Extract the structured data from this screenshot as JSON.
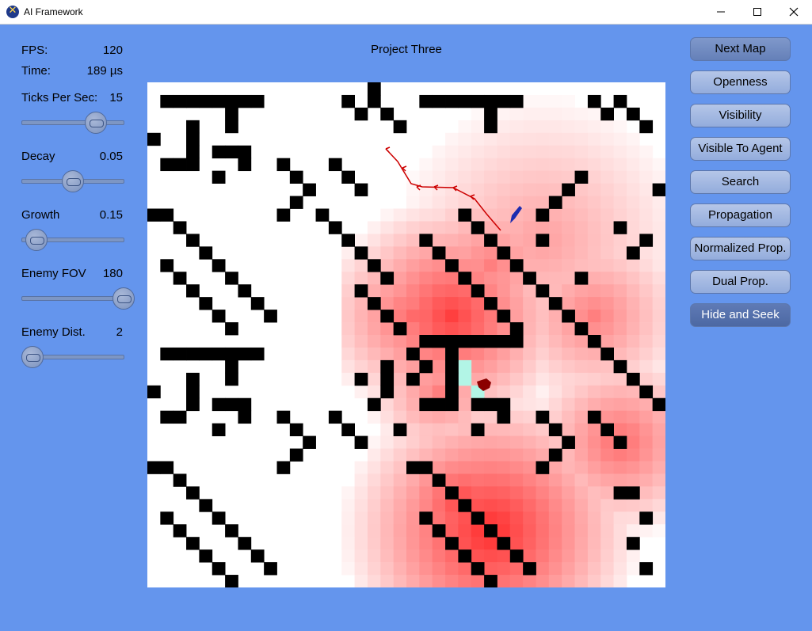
{
  "window": {
    "title": "AI Framework",
    "icon": "app-x-icon"
  },
  "stats": {
    "fps_label": "FPS:",
    "fps_value": "120",
    "time_label": "Time:",
    "time_value": "189 µs"
  },
  "sliders": [
    {
      "label": "Ticks Per Sec:",
      "value": "15",
      "level": 0.73
    },
    {
      "label": "Decay",
      "value": "0.05",
      "level": 0.5
    },
    {
      "label": "Growth",
      "value": "0.15",
      "level": 0.14
    },
    {
      "label": "Enemy FOV",
      "value": "180",
      "level": 1.0
    },
    {
      "label": "Enemy Dist.",
      "value": "2",
      "level": 0.1
    }
  ],
  "project_title": "Project Three",
  "buttons": [
    {
      "label": "Next Map",
      "state": "active"
    },
    {
      "label": "Openness",
      "state": "normal"
    },
    {
      "label": "Visibility",
      "state": "normal"
    },
    {
      "label": "Visible To Agent",
      "state": "normal"
    },
    {
      "label": "Search",
      "state": "normal"
    },
    {
      "label": "Propagation",
      "state": "normal"
    },
    {
      "label": "Normalized Prop.",
      "state": "normal"
    },
    {
      "label": "Dual Prop.",
      "state": "normal"
    },
    {
      "label": "Hide and Seek",
      "state": "selected"
    }
  ],
  "colors": {
    "background": "#6495ed",
    "wall": "#000000",
    "heat_max": "#ff2a2a",
    "visible_cell": "#b2f5e6",
    "agent": "#1c2bb0",
    "enemy": "#8b0000",
    "path": "#cc0000"
  }
}
